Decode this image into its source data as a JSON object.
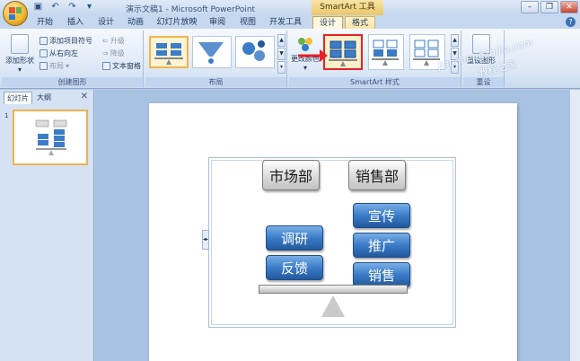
{
  "window": {
    "title": "演示文稿1 - Microsoft PowerPoint",
    "context_title": "SmartArt 工具"
  },
  "tabs": [
    {
      "label": "开始"
    },
    {
      "label": "插入"
    },
    {
      "label": "设计"
    },
    {
      "label": "动画"
    },
    {
      "label": "幻灯片放映"
    },
    {
      "label": "审阅"
    },
    {
      "label": "视图"
    },
    {
      "label": "开发工具"
    },
    {
      "label": "设计"
    },
    {
      "label": "格式"
    }
  ],
  "ribbon": {
    "create_graphic": {
      "label": "创建图形",
      "add_shape": "添加形状",
      "add_bullet": "添加项目符号",
      "right_to_left": "从右向左",
      "layout": "布局",
      "promote": "升级",
      "demote": "降级",
      "text_pane": "文本窗格"
    },
    "layouts": {
      "label": "布局"
    },
    "styles": {
      "label": "SmartArt 样式",
      "change_colors": "更改颜色"
    },
    "reset": {
      "label": "重设",
      "reset_graphic": "重设图形"
    }
  },
  "watermark": {
    "line1": "jiaochengzhijia.com",
    "line2": "教程之家"
  },
  "panel": {
    "tab_slides": "幻灯片",
    "tab_outline": "大纲",
    "slide_number": "1"
  },
  "smartart": {
    "left_header": "市场部",
    "right_header": "销售部",
    "left_items": [
      "调研",
      "反馈"
    ],
    "right_items": [
      "宣传",
      "推广",
      "销售"
    ]
  },
  "colors": {
    "accent_blue": "#3a7cc7",
    "selected_border": "#e8202a",
    "ribbon_bg": "#dce8f6"
  }
}
